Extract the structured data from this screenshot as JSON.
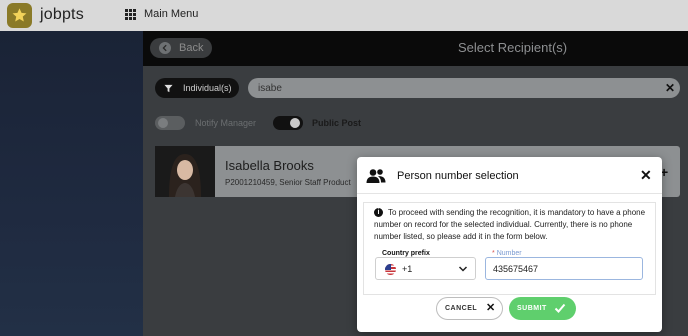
{
  "app": {
    "brand": "jobpts",
    "main_menu_label": "Main Menu"
  },
  "header": {
    "back_label": "Back",
    "title": "Select Recipient(s)"
  },
  "filters": {
    "type_label": "Individual(s)",
    "search_value": "isabe",
    "notify_manager_label": "Notify Manager",
    "notify_manager_on": false,
    "public_post_label": "Public Post",
    "public_post_on": true
  },
  "person": {
    "name": "Isabella Brooks",
    "subtitle": "P2001210459, Senior Staff Product"
  },
  "modal": {
    "title": "Person number selection",
    "info_text": "To proceed with sending the recognition, it is mandatory to have a phone number on record for the selected individual. Currently, there is no phone number listed, so please add it in the form below.",
    "prefix_label": "Country prefix",
    "prefix_value": "+1",
    "number_label": "Number",
    "number_required_mark": "*",
    "number_value": "435675467",
    "cancel_label": "CANCEL",
    "submit_label": "SUBMIT"
  },
  "colors": {
    "accent_submit": "#5fcf6d",
    "brand_badge": "#8a7a28"
  }
}
